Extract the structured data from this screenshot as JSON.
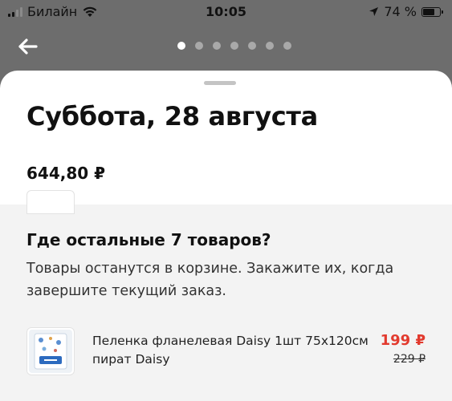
{
  "status_bar": {
    "carrier": "Билайн",
    "time": "10:05",
    "battery_text": "74 %",
    "battery_level": 0.74,
    "icons": [
      "signal-icon",
      "wifi-icon",
      "location-arrow-icon",
      "battery-icon"
    ]
  },
  "header": {
    "back_icon": "arrow-left-icon",
    "pager": {
      "count": 7,
      "active_index": 0
    }
  },
  "delivery": {
    "title": "Суббота, 28 августа",
    "total": "644,80 ₽"
  },
  "notice": {
    "title": "Где остальные 7 товаров?",
    "text": "Товары останутся в корзине. Закажите их, когда завершите текущий заказ."
  },
  "items": [
    {
      "name": "Пеленка фланелевая Daisy 1шт 75х120см пират Daisy",
      "price": "199 ₽",
      "old_price": "229 ₽"
    }
  ],
  "colors": {
    "overlay": "#6d6d6d",
    "sheet": "#ffffff",
    "section_bg": "#f3f3f3",
    "sale_price": "#e23a2e"
  }
}
